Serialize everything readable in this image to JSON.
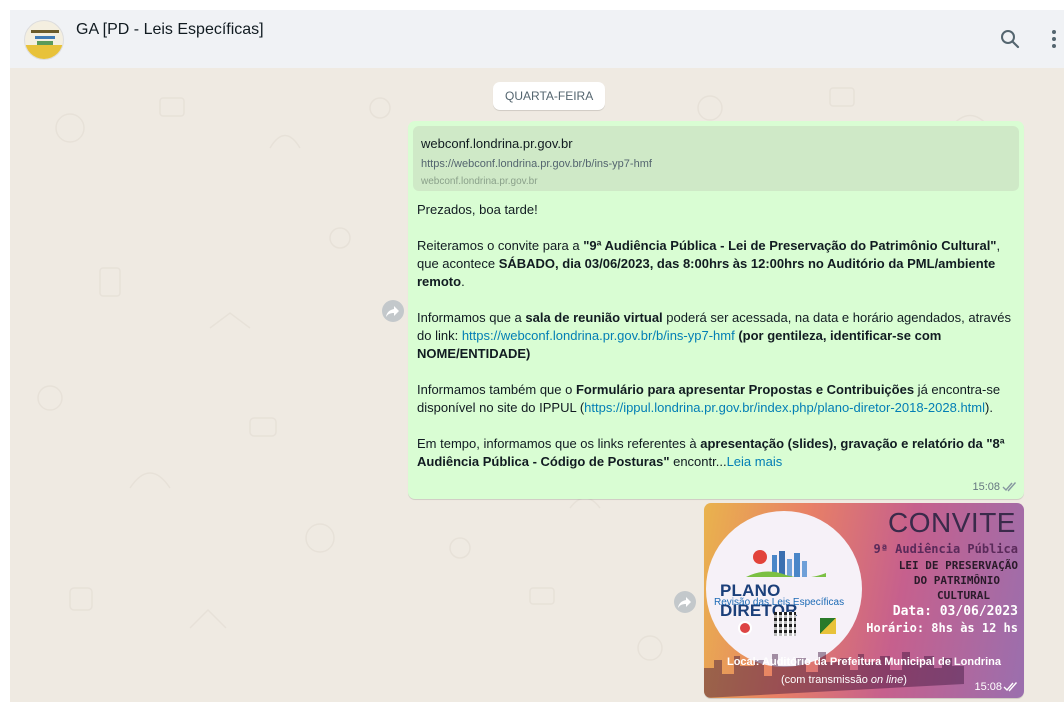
{
  "header": {
    "title": "GA [PD - Leis Específicas]",
    "icons": [
      "search-icon",
      "kebab-menu-icon"
    ]
  },
  "chat": {
    "day_divider": "QUARTA-FEIRA",
    "message1": {
      "link_preview": {
        "domain": "webconf.londrina.pr.gov.br",
        "url": "https://webconf.londrina.pr.gov.br/b/ins-yp7-hmf",
        "sub": "webconf.londrina.pr.gov.br"
      },
      "p1": "Prezados, boa tarde!",
      "p2_a": "Reiteramos o convite para a ",
      "p2_b": "\"9ª Audiência Pública - Lei de Preservação do Patrimônio Cultural\"",
      "p2_c": ", que acontece ",
      "p2_d": "SÁBADO, dia 03/06/2023, das 8:00hrs às 12:00hrs no Auditório da PML/ambiente remoto",
      "p2_e": ".",
      "p3_a": "Informamos que a ",
      "p3_b": "sala de reunião virtual",
      "p3_c": " poderá ser acessada, na data e horário agendados, através do link: ",
      "p3_link": "https://webconf.londrina.pr.gov.br/b/ins-yp7-hmf",
      "p3_d": " (por gentileza, identificar-se com NOME/ENTIDADE)",
      "p4_a": "Informamos também que o ",
      "p4_b": "Formulário para apresentar Propostas e Contribuições",
      "p4_c": " já encontra-se disponível no site do IPPUL (",
      "p4_link": "https://ippul.londrina.pr.gov.br/index.php/plano-diretor-2018-2028.html",
      "p4_d": ").",
      "p5_a": "Em tempo, informamos que os links referentes à ",
      "p5_b": "apresentação (slides), gravação e relatório da \"8ª Audiência Pública - Código de Posturas\"",
      "p5_c": " encontr...",
      "read_more": "Leia mais",
      "time": "15:08"
    },
    "message2": {
      "image": {
        "convite": "CONVITE",
        "line1": "9ª Audiência Pública",
        "line2": "LEI DE PRESERVAÇÃO",
        "line3": "DO PATRIMÔNIO",
        "line4": "CULTURAL",
        "line5": "Data: 03/06/2023",
        "line6": "Horário: 8hs às 12 hs",
        "plano": "PLANO DIRETOR",
        "revisao": "Revisão das Leis Específicas",
        "local": "Local: Auditório da Prefeitura Municipal de Londrina",
        "transmissao_a": "(com transmissão ",
        "transmissao_b": "on line",
        "transmissao_c": ")"
      },
      "time": "15:08"
    }
  },
  "colors": {
    "header_bg": "#f0f2f5",
    "chat_bg": "#efeae2",
    "outgoing_bubble": "#d9fdd3",
    "link": "#027eb5",
    "read_ticks": "#53bdeb"
  }
}
